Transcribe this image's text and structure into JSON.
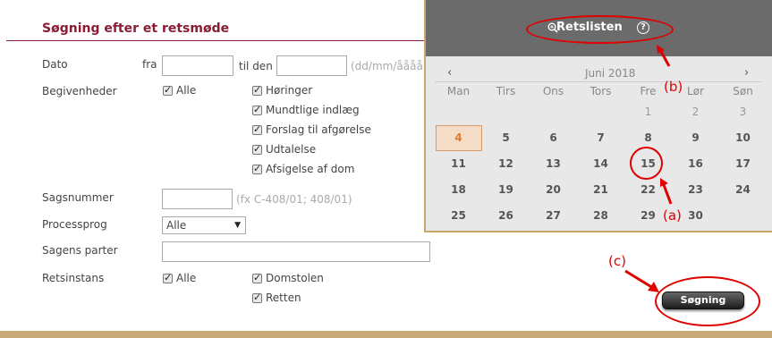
{
  "form": {
    "title": "Søgning efter et retsmøde",
    "date_label": "Dato",
    "date_from": "fra",
    "date_to": "til den",
    "date_hint": "(dd/mm/åååå)",
    "events_label": "Begivenheder",
    "events_all": "Alle",
    "events": [
      "Høringer",
      "Mundtlige indlæg",
      "Forslag til afgørelse",
      "Udtalelse",
      "Afsigelse af dom"
    ],
    "case_number_label": "Sagsnummer",
    "case_number_hint": "(fx C-408/01; 408/01)",
    "language_label": "Processprog",
    "language_value": "Alle",
    "parties_label": "Sagens parter",
    "court_label": "Retsinstans",
    "court_all": "Alle",
    "courts": [
      "Domstolen",
      "Retten"
    ],
    "search_button": "Søgning"
  },
  "calendar": {
    "header_title": "Retslisten",
    "prev": "‹",
    "next": "›",
    "month": "Juni 2018",
    "weekdays": [
      "Man",
      "Tirs",
      "Ons",
      "Tors",
      "Fre",
      "Lør",
      "Søn"
    ],
    "weeks": [
      [
        "",
        "",
        "",
        "",
        "1",
        "2",
        "3"
      ],
      [
        "4",
        "5",
        "6",
        "7",
        "8",
        "9",
        "10"
      ],
      [
        "11",
        "12",
        "13",
        "14",
        "15",
        "16",
        "17"
      ],
      [
        "18",
        "19",
        "20",
        "21",
        "22",
        "23",
        "24"
      ],
      [
        "25",
        "26",
        "27",
        "28",
        "29",
        "30",
        ""
      ]
    ],
    "highlighted_day": "4"
  },
  "annotations": {
    "a": "(a)",
    "b": "(b)",
    "c": "(c)",
    "color": "#e00000"
  }
}
